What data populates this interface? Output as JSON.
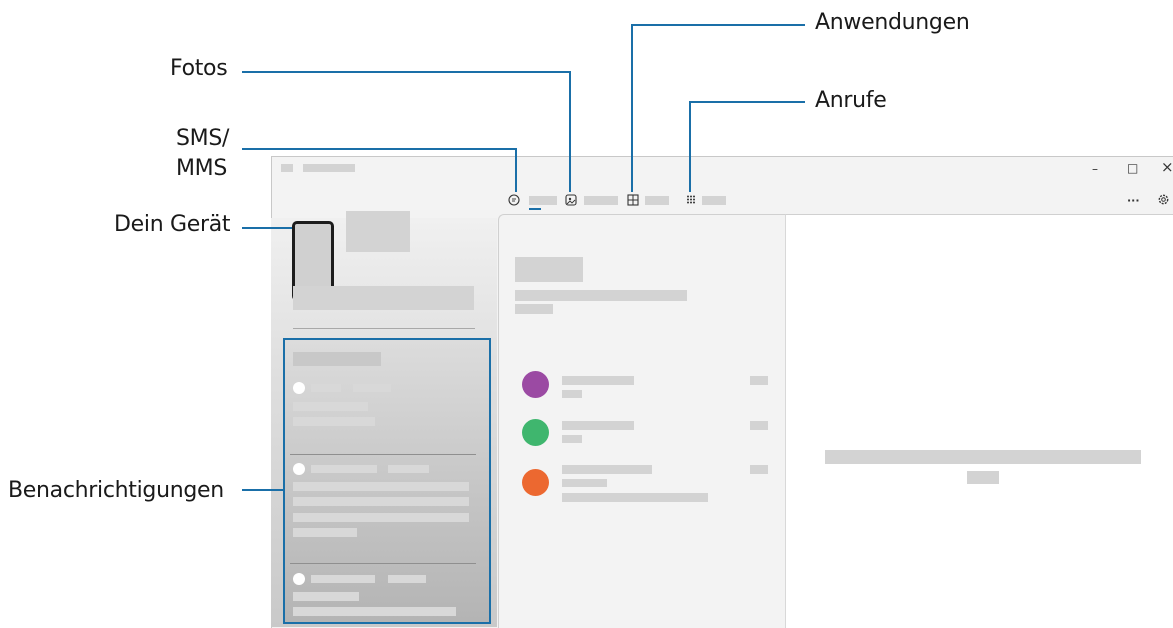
{
  "callouts": {
    "fotos": "Fotos",
    "sms": "SMS/",
    "mms": "MMS",
    "device": "Dein Gerät",
    "notifications": "Benachrichtigungen",
    "apps": "Anwendungen",
    "calls": "Anrufe"
  },
  "window_controls": {
    "minimize": "–",
    "maximize": "□",
    "close": "×",
    "more": "···"
  },
  "colors": {
    "callout_line": "#1a6fa8",
    "avatar_1": "#9b4aa3",
    "avatar_2": "#3fb66e",
    "avatar_3": "#ec6830"
  },
  "icons": {
    "messages": "chat-bubble-icon",
    "photos": "image-icon",
    "apps": "grid-icon",
    "calls": "dialpad-icon",
    "settings": "gear-icon"
  }
}
